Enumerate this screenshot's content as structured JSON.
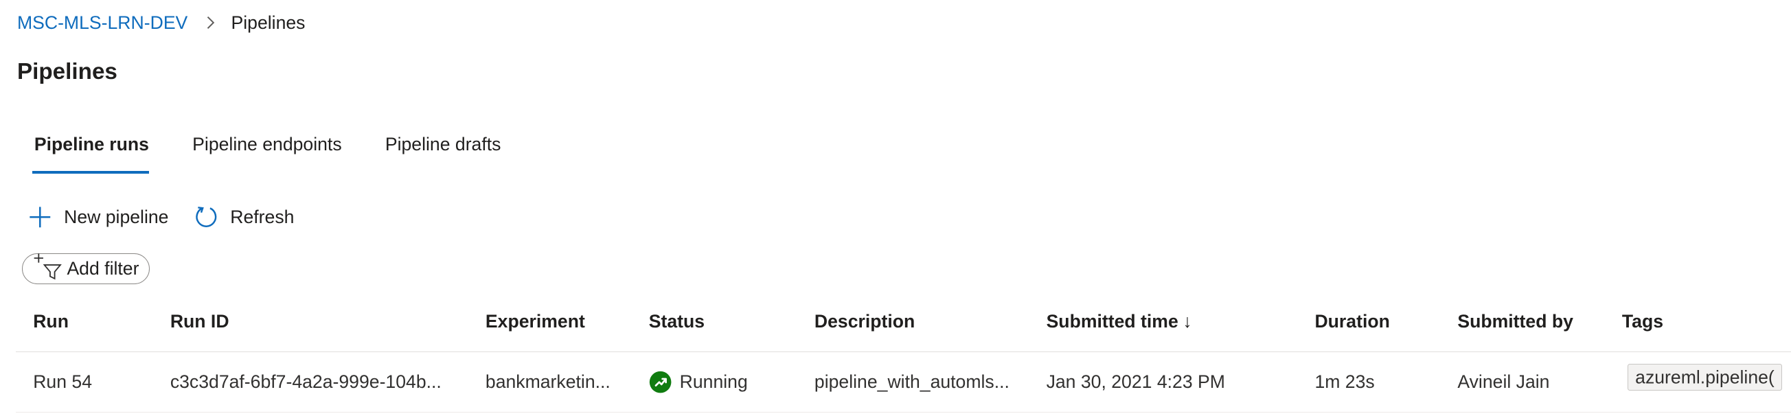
{
  "breadcrumb": {
    "workspace": "MSC-MLS-LRN-DEV",
    "current": "Pipelines"
  },
  "page": {
    "title": "Pipelines"
  },
  "tabs": [
    {
      "label": "Pipeline runs",
      "active": true
    },
    {
      "label": "Pipeline endpoints",
      "active": false
    },
    {
      "label": "Pipeline drafts",
      "active": false
    }
  ],
  "toolbar": {
    "new_label": "New pipeline",
    "refresh_label": "Refresh"
  },
  "filter": {
    "label": "Add filter"
  },
  "table": {
    "columns": [
      "Run",
      "Run ID",
      "Experiment",
      "Status",
      "Description",
      "Submitted time",
      "Duration",
      "Submitted by",
      "Tags"
    ],
    "sort_indicator": "↓",
    "rows": [
      {
        "run": "Run 54",
        "run_id": "c3c3d7af-6bf7-4a2a-999e-104b...",
        "experiment": "bankmarketin...",
        "status": "Running",
        "description": "pipeline_with_automls...",
        "submitted_time": "Jan 30, 2021 4:23 PM",
        "duration": "1m 23s",
        "submitted_by": "Avineil Jain",
        "tag": "azureml.pipeline("
      }
    ]
  },
  "colors": {
    "link": "#0f6cbd",
    "running_status": "#107c10",
    "text": "#201f1e"
  },
  "icons": {
    "breadcrumb_separator": "chevron-right-icon",
    "new": "plus-icon",
    "refresh": "refresh-icon",
    "filter": "add-filter-icon",
    "status": "running-status-icon"
  }
}
